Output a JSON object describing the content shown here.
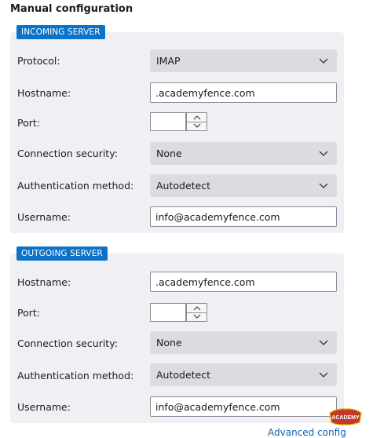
{
  "title": "Manual configuration",
  "incoming": {
    "badge": "INCOMING SERVER",
    "protocol_label": "Protocol:",
    "protocol_value": "IMAP",
    "hostname_label": "Hostname:",
    "hostname_value": ".academyfence.com",
    "port_label": "Port:",
    "port_value": "",
    "security_label": "Connection security:",
    "security_value": "None",
    "auth_label": "Authentication method:",
    "auth_value": "Autodetect",
    "username_label": "Username:",
    "username_value": "info@academyfence.com"
  },
  "outgoing": {
    "badge": "OUTGOING SERVER",
    "hostname_label": "Hostname:",
    "hostname_value": ".academyfence.com",
    "port_label": "Port:",
    "port_value": "",
    "security_label": "Connection security:",
    "security_value": "None",
    "auth_label": "Authentication method:",
    "auth_value": "Autodetect",
    "username_label": "Username:",
    "username_value": "info@academyfence.com"
  },
  "advanced_link": "Advanced config",
  "logo_text": "ACADEMY",
  "colors": {
    "accent": "#0a73c9",
    "panel": "#f0f0f4",
    "select": "#dcdce0"
  },
  "icons": {
    "dropdown": "chevron-down-icon",
    "spin_up": "chevron-up-icon",
    "spin_down": "chevron-down-icon"
  }
}
